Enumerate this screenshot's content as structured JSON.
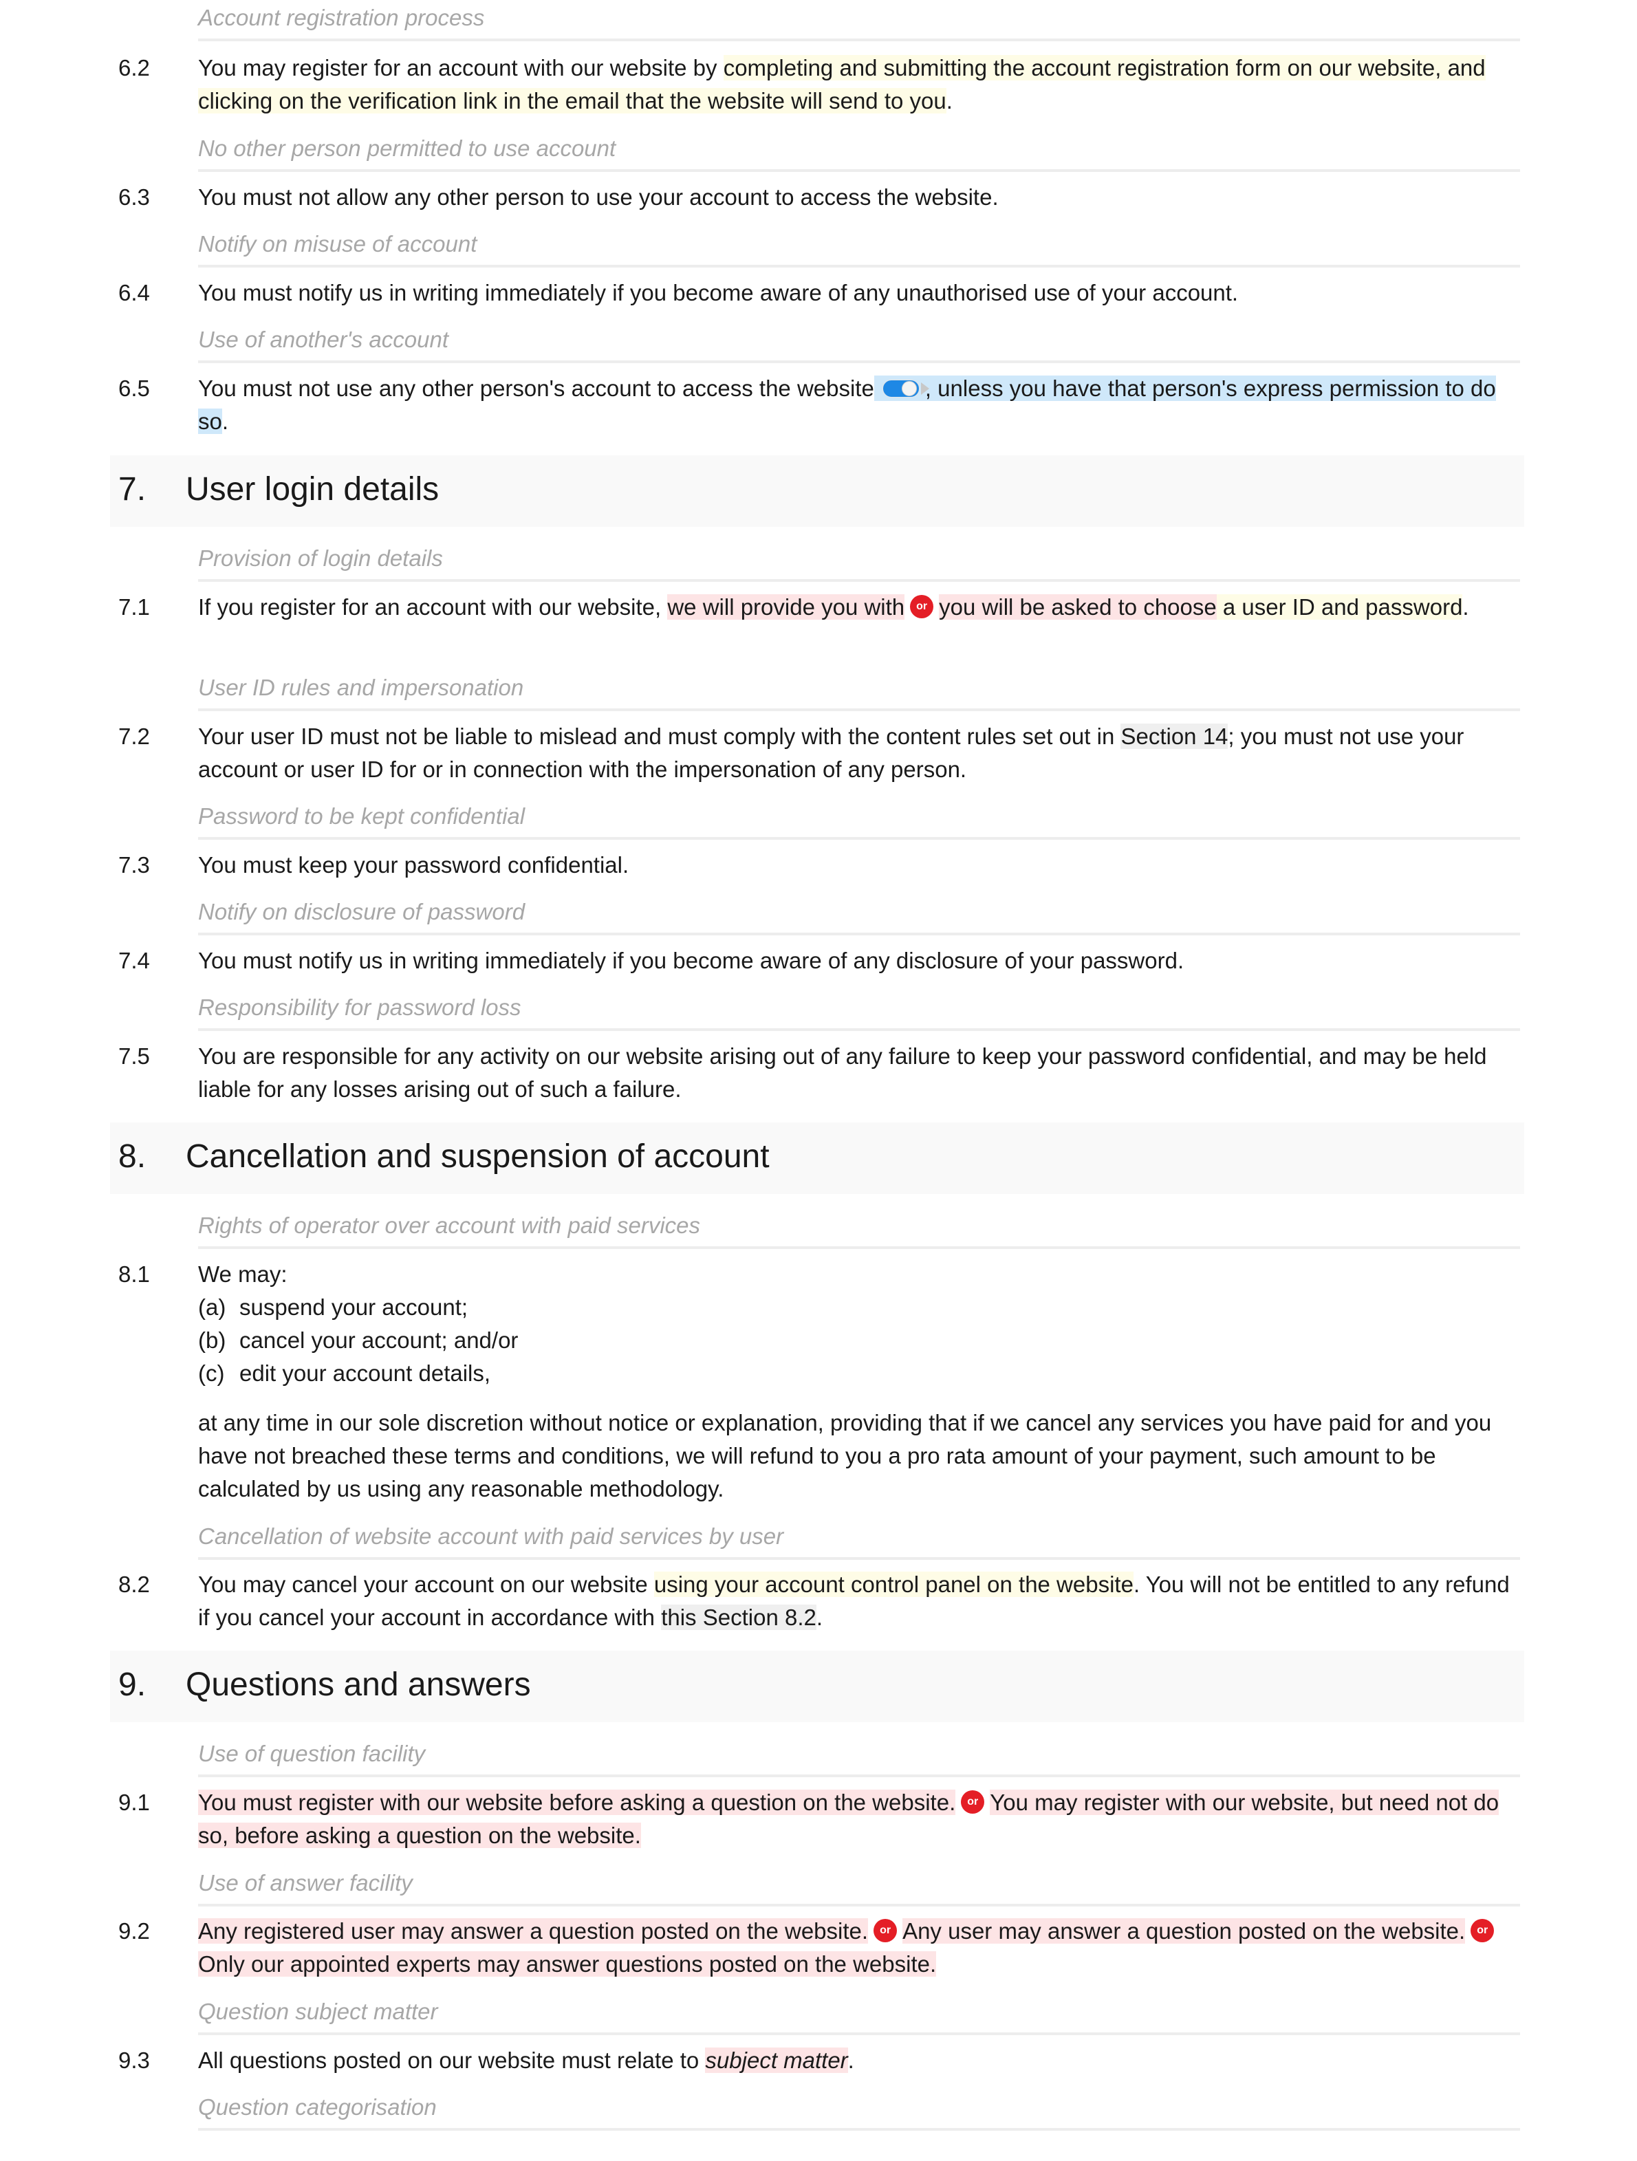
{
  "colors": {
    "highlight_optional": "#fefce6",
    "highlight_alternative": "#fde4e5",
    "highlight_toggle": "#cfe8fa",
    "highlight_crossref": "#efefef",
    "or_badge": "#e41e26",
    "toggle_on": "#1e88e5",
    "subheading_text": "#a7a7a7",
    "section_band": "#f9f9f9"
  },
  "badges": {
    "or_label": "or"
  },
  "icons": {
    "toggle": "toggle-switch-icon",
    "or": "or-badge-icon"
  },
  "sections": {
    "s6": {
      "c62": {
        "subheading": "Account registration process",
        "num": "6.2",
        "t1": "You may register for an account with our website by ",
        "h1": "completing and submitting the account registration form on our website, and clicking on the verification link in the email that the website will send to you",
        "t2": "."
      },
      "c63": {
        "subheading": "No other person permitted to use account",
        "num": "6.3",
        "text": "You must not allow any other person to use your account to access the website."
      },
      "c64": {
        "subheading": "Notify on misuse of account",
        "num": "6.4",
        "text": "You must notify us in writing immediately if you become aware of any unauthorised use of your account."
      },
      "c65": {
        "subheading": "Use of another's account",
        "num": "6.5",
        "t1": "You must not use any other person's account to access the website",
        "h1": ", unless you have that person's express permission to do so",
        "t2": ".",
        "toggle_state": "on"
      }
    },
    "s7": {
      "number": "7.",
      "title": "User login details",
      "c71": {
        "subheading": "Provision of login details",
        "num": "7.1",
        "t1": "If you register for an account with our website, ",
        "alt1": "we will provide you with",
        "alt2": "you will be asked to choose",
        "h1": " a user ID and password",
        "t2": "."
      },
      "c72": {
        "subheading": "User ID rules and impersonation",
        "num": "7.2",
        "t1": "Your user ID must not be liable to mislead and must comply with the content rules set out in ",
        "ref": "Section 14",
        "t2": "; you must not use your account or user ID for or in connection with the impersonation of any person."
      },
      "c73": {
        "subheading": "Password to be kept confidential",
        "num": "7.3",
        "text": "You must keep your password confidential."
      },
      "c74": {
        "subheading": "Notify on disclosure of password",
        "num": "7.4",
        "text": "You must notify us in writing immediately if you become aware of any disclosure of your password."
      },
      "c75": {
        "subheading": "Responsibility for password loss",
        "num": "7.5",
        "text": "You are responsible for any activity on our website arising out of any failure to keep your password confidential, and may be held liable for any losses arising out of such a failure."
      }
    },
    "s8": {
      "number": "8.",
      "title": "Cancellation and suspension of account",
      "c81": {
        "subheading": "Rights of operator over account with paid services",
        "num": "8.1",
        "intro": "We may:",
        "items": [
          {
            "label": "(a)",
            "text": "suspend your account;"
          },
          {
            "label": "(b)",
            "text": "cancel your account; and/or"
          },
          {
            "label": "(c)",
            "text": "edit your account details,"
          }
        ],
        "outro": "at any time in our sole discretion without notice or explanation, providing that if we cancel any services you have paid for and you have not breached these terms and conditions, we will refund to you a pro rata amount of your payment, such amount to be calculated by us using any reasonable methodology."
      },
      "c82": {
        "subheading": "Cancellation of website account with paid services by user",
        "num": "8.2",
        "t1": "You may cancel your account on our website ",
        "h1": "using your account control panel on the website",
        "t2": ". You will not be entitled to any refund if you cancel your account in accordance with ",
        "ref": "this Section 8.2",
        "t3": "."
      }
    },
    "s9": {
      "number": "9.",
      "title": "Questions and answers",
      "c91": {
        "subheading": "Use of question facility",
        "num": "9.1",
        "alt1": "You must register with our website before asking a question on the website.",
        "alt2": "You may register with our website, but need not do so, before asking a question on the website."
      },
      "c92": {
        "subheading": "Use of answer facility",
        "num": "9.2",
        "alt1": "Any registered user may answer a question posted on the website.",
        "alt2": "Any user may answer a question posted on the website.",
        "alt3": "Only our appointed experts may answer questions posted on the website."
      },
      "c93": {
        "subheading": "Question subject matter",
        "num": "9.3",
        "t1": "All questions posted on our website must relate to ",
        "var": "subject matter",
        "t2": "."
      },
      "c94": {
        "subheading": "Question categorisation"
      }
    }
  }
}
